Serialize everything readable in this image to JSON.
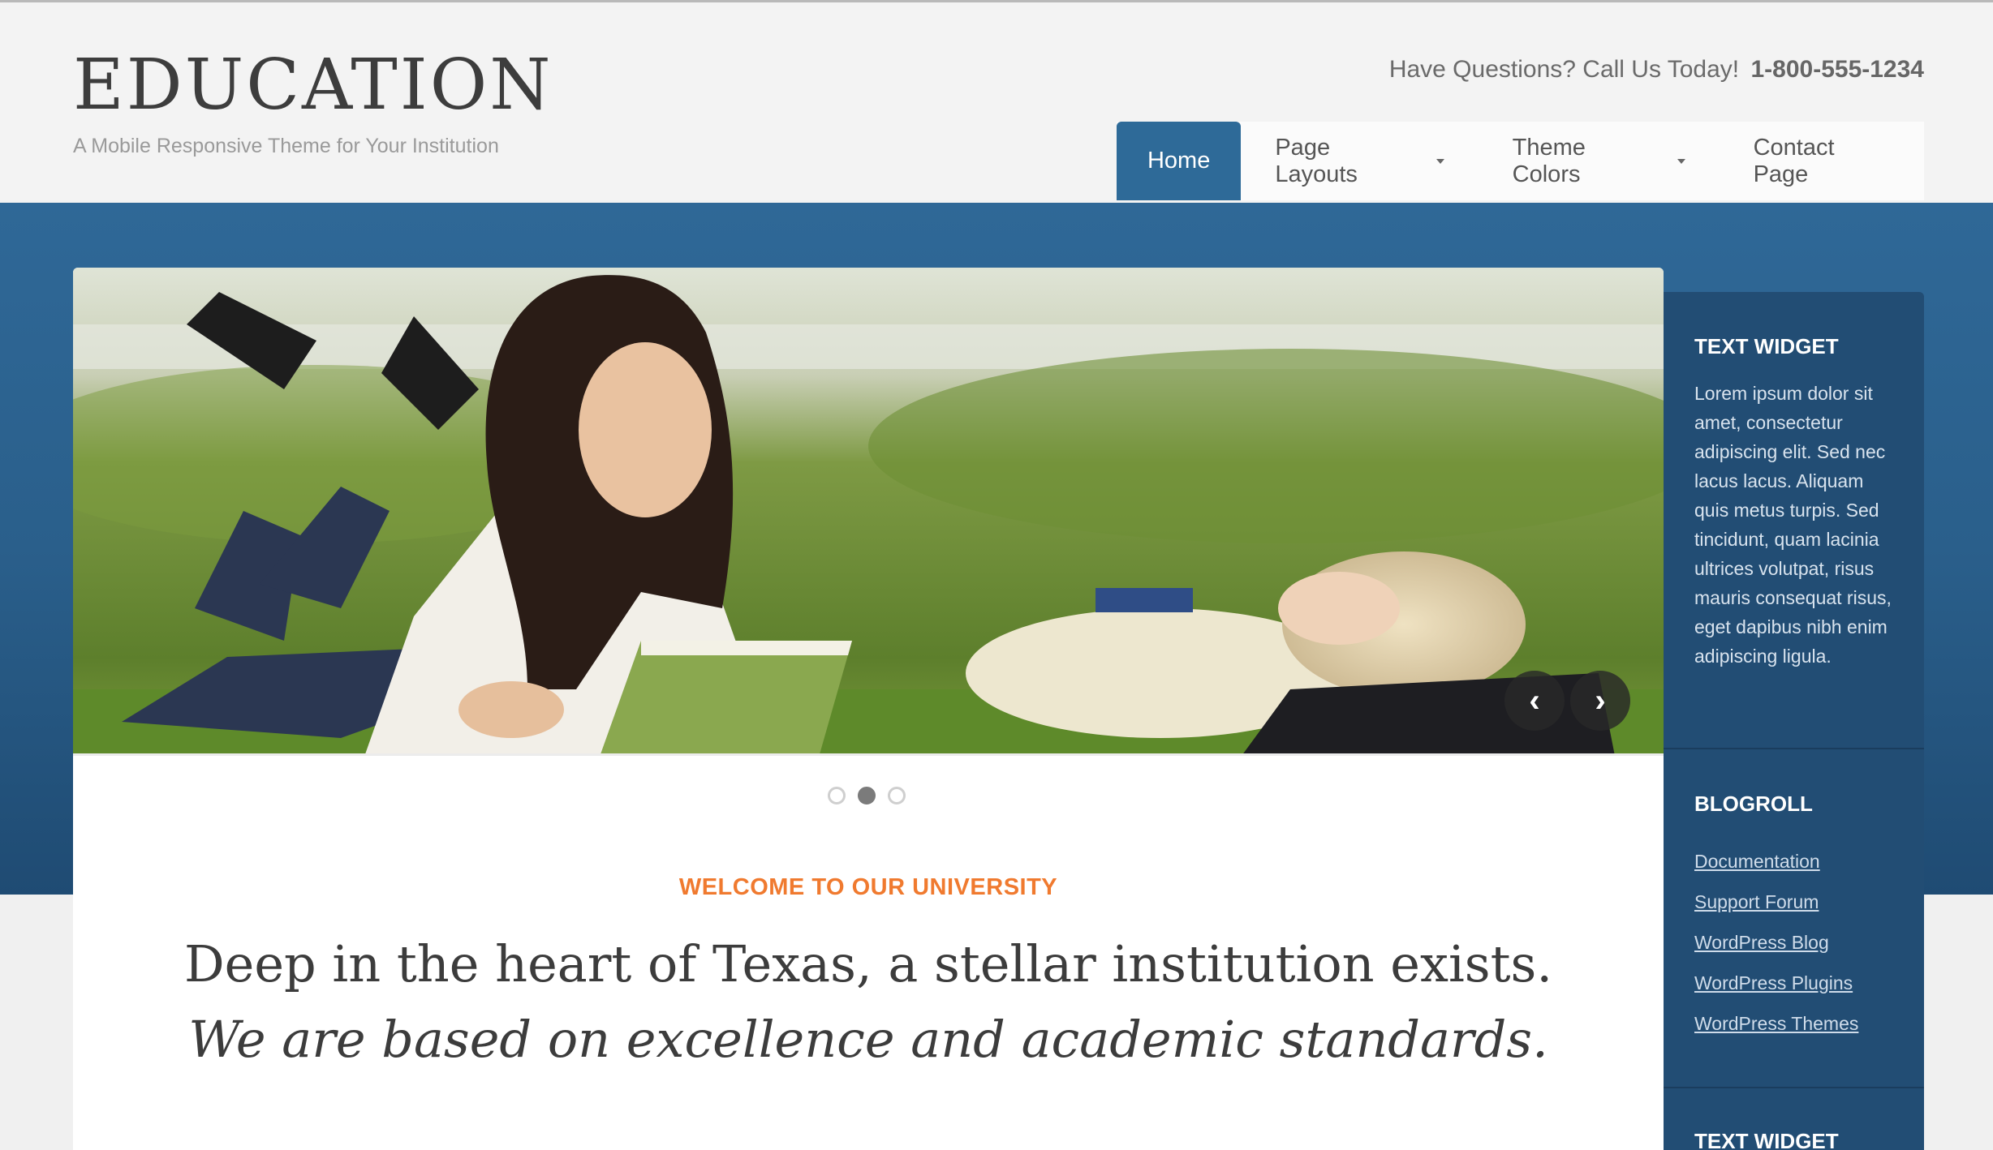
{
  "header": {
    "site_title": "EDUCATION",
    "tagline": "A Mobile Responsive Theme for Your Institution",
    "contact_text": "Have Questions? Call Us Today!",
    "contact_phone": "1-800-555-1234"
  },
  "nav": {
    "items": [
      {
        "label": "Home"
      },
      {
        "label": "Page Layouts"
      },
      {
        "label": "Theme Colors"
      },
      {
        "label": "Contact Page"
      }
    ]
  },
  "slider": {
    "prev_icon": "chevron-left-icon",
    "next_icon": "chevron-right-icon",
    "active_slide": 2,
    "total_slides": 3
  },
  "main": {
    "welcome": "WELCOME TO OUR UNIVERSITY",
    "headline": "Deep in the heart of Texas, a stellar institution exists.",
    "subline": "We are based on excellence and academic standards."
  },
  "sidebar": {
    "text_widget_title": "TEXT WIDGET",
    "text_widget_body": "Lorem ipsum dolor sit amet, consectetur adipiscing elit. Sed nec lacus lacus. Aliquam quis metus turpis. Sed tincidunt, quam lacinia ultrices volutpat, risus mauris consequat risus, eget dapibus nibh enim adipiscing ligula.",
    "blogroll_title": "BLOGROLL",
    "blogroll": [
      "Documentation",
      "Support Forum",
      "WordPress Blog",
      "WordPress Plugins",
      "WordPress Themes"
    ],
    "text_widget_2_title": "TEXT WIDGET"
  },
  "colors": {
    "accent_blue": "#2e6a98",
    "sidebar_blue": "#224d74",
    "welcome_orange": "#f07a2f"
  }
}
